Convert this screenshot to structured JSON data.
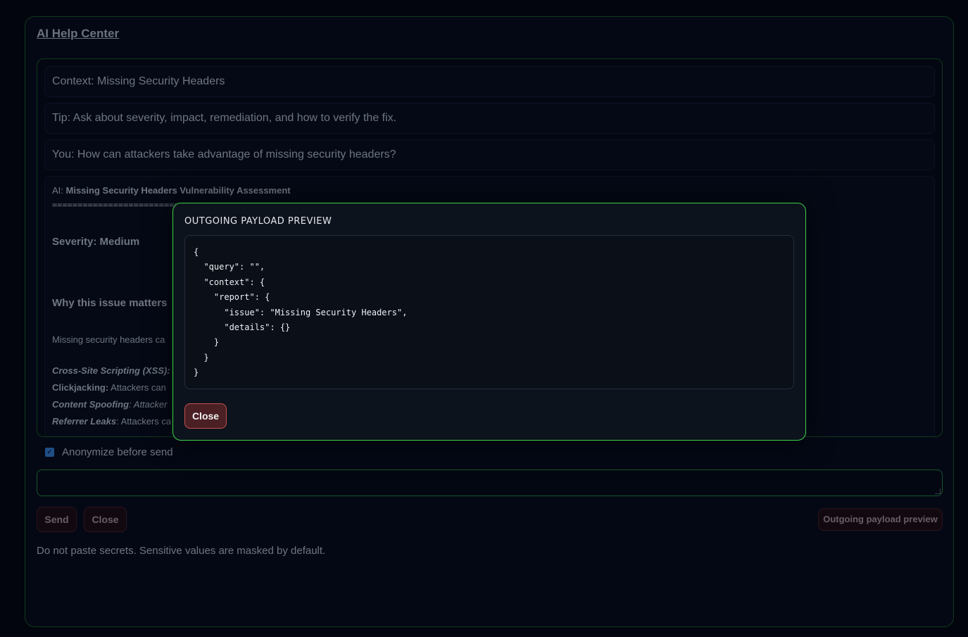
{
  "panel": {
    "title": "AI Help Center"
  },
  "chat": {
    "messages": [
      {
        "text": "Context: Missing Security Headers"
      },
      {
        "text": "Tip: Ask about severity, impact, remediation, and how to verify the fix."
      },
      {
        "text": "You: How can attackers take advantage of missing security headers?"
      }
    ],
    "ai": {
      "prefix": "AI: ",
      "heading": "Missing Security Headers Vulnerability Assessment",
      "separator": "======================================",
      "severity": "Severity: Medium",
      "why": "Why this issue matters",
      "para": "Missing security headers ca",
      "bullets": [
        {
          "label": "Cross-Site Scripting (XSS):",
          "text": ""
        },
        {
          "label": "Clickjacking:",
          "text": " Attackers can"
        },
        {
          "label": "Content Spoofing",
          "text": ": Attacker"
        },
        {
          "label": "Referrer Leaks",
          "text": ": Attackers ca"
        }
      ]
    }
  },
  "anonymize": {
    "label": "Anonymize before send",
    "checked": true
  },
  "input": {
    "value": ""
  },
  "buttons": {
    "send": "Send",
    "close": "Close",
    "preview": "Outgoing payload preview"
  },
  "footnote": "Do not paste secrets. Sensitive values are masked by default.",
  "modal": {
    "title": "OUTGOING PAYLOAD PREVIEW",
    "payload": "{\n  \"query\": \"\",\n  \"context\": {\n    \"report\": {\n      \"issue\": \"Missing Security Headers\",\n      \"details\": {}\n    }\n  }\n}",
    "close_label": "Close"
  },
  "colors": {
    "accent_border": "#3bd14a",
    "danger_button": "#4a2024",
    "checkbox": "#1f4f86"
  }
}
